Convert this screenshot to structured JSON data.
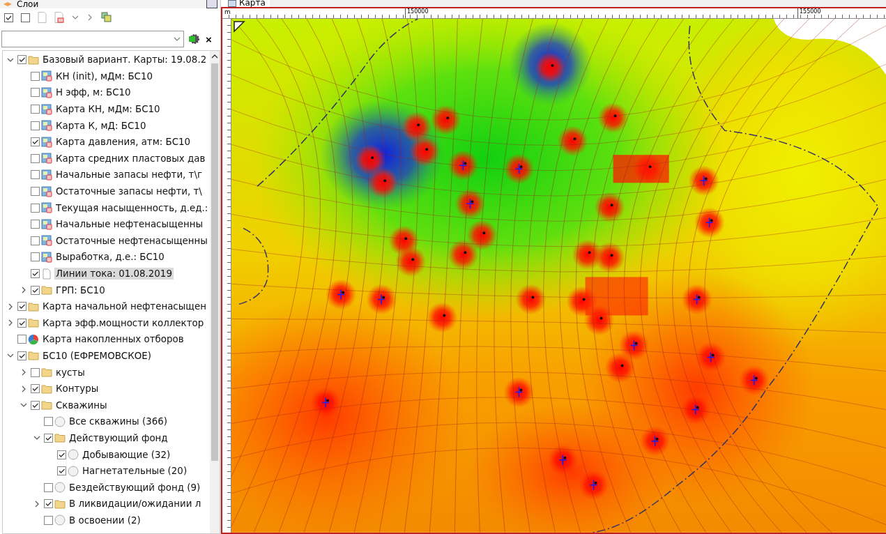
{
  "layers_panel": {
    "title": "Слои",
    "clear_button": "×"
  },
  "layers": [
    {
      "label": "Базовый вариант. Карты: 19.08.2",
      "kind": "folder",
      "checked": true,
      "expanded": true,
      "selected": false,
      "children": [
        {
          "label": "КН (init), мДм: БС10",
          "kind": "map",
          "checked": false,
          "selected": false
        },
        {
          "label": "Н эфф, м: БС10",
          "kind": "map",
          "checked": false,
          "selected": false
        },
        {
          "label": "Карта КН, мДм: БС10",
          "kind": "map",
          "checked": false,
          "selected": false
        },
        {
          "label": "Карта К, мД: БС10",
          "kind": "map",
          "checked": false,
          "selected": false
        },
        {
          "label": "Карта давления, атм: БС10",
          "kind": "map",
          "checked": true,
          "selected": false
        },
        {
          "label": "Карта средних пластовых дав",
          "kind": "map",
          "checked": false,
          "selected": false
        },
        {
          "label": "Начальные запасы нефти, т\\г",
          "kind": "map",
          "checked": false,
          "selected": false
        },
        {
          "label": "Остаточные запасы нефти, т\\",
          "kind": "map",
          "checked": false,
          "selected": false
        },
        {
          "label": "Текущая насыщенность, д.ед.:",
          "kind": "map",
          "checked": false,
          "selected": false
        },
        {
          "label": "Начальные нефтенасыщенны",
          "kind": "map",
          "checked": false,
          "selected": false
        },
        {
          "label": "Остаточные нефтенасыщенны",
          "kind": "map",
          "checked": false,
          "selected": false
        },
        {
          "label": "Выработка, д.е.: БС10",
          "kind": "map",
          "checked": false,
          "selected": false
        },
        {
          "label": "Линии тока: 01.08.2019",
          "kind": "doc",
          "checked": true,
          "selected": true
        },
        {
          "label": "ГРП: БС10",
          "kind": "folder",
          "checked": true,
          "expanded": false,
          "selected": false
        }
      ]
    },
    {
      "label": "Карта начальной нефтенасыщен",
      "kind": "folder",
      "checked": true,
      "expanded": false,
      "selected": false
    },
    {
      "label": "Карта эфф.мощности коллектор",
      "kind": "folder",
      "checked": true,
      "expanded": false,
      "selected": false
    },
    {
      "label": "Карта накопленных отборов",
      "kind": "pie",
      "checked": false,
      "selected": false
    },
    {
      "label": "БС10 (ЕФРЕМОВСКОЕ)",
      "kind": "folder",
      "checked": true,
      "expanded": true,
      "selected": false,
      "children": [
        {
          "label": "кусты",
          "kind": "folder",
          "checked": false,
          "expanded": false,
          "selected": false
        },
        {
          "label": "Контуры",
          "kind": "folder",
          "checked": true,
          "expanded": false,
          "selected": false
        },
        {
          "label": "Скважины",
          "kind": "folder",
          "checked": true,
          "expanded": true,
          "selected": false,
          "children": [
            {
              "label": "Все скважины (366)",
              "kind": "well",
              "checked": false,
              "selected": false
            },
            {
              "label": "Действующий фонд",
              "kind": "folder",
              "checked": true,
              "expanded": true,
              "selected": false,
              "children": [
                {
                  "label": "Добывающие (32)",
                  "kind": "well",
                  "checked": true,
                  "selected": false
                },
                {
                  "label": "Нагнетательные (20)",
                  "kind": "well",
                  "checked": true,
                  "selected": false
                }
              ]
            },
            {
              "label": "Бездействующий фонд (9)",
              "kind": "well",
              "checked": false,
              "selected": false
            },
            {
              "label": "В ликвидации/ожидании л",
              "kind": "folder",
              "checked": true,
              "expanded": false,
              "selected": false
            },
            {
              "label": "В освоении (2)",
              "kind": "well",
              "checked": false,
              "selected": false
            }
          ]
        }
      ]
    }
  ],
  "map_window": {
    "title": "Карта",
    "ruler_unit": "m",
    "ruler_labels": [
      "150000",
      "155000"
    ]
  }
}
